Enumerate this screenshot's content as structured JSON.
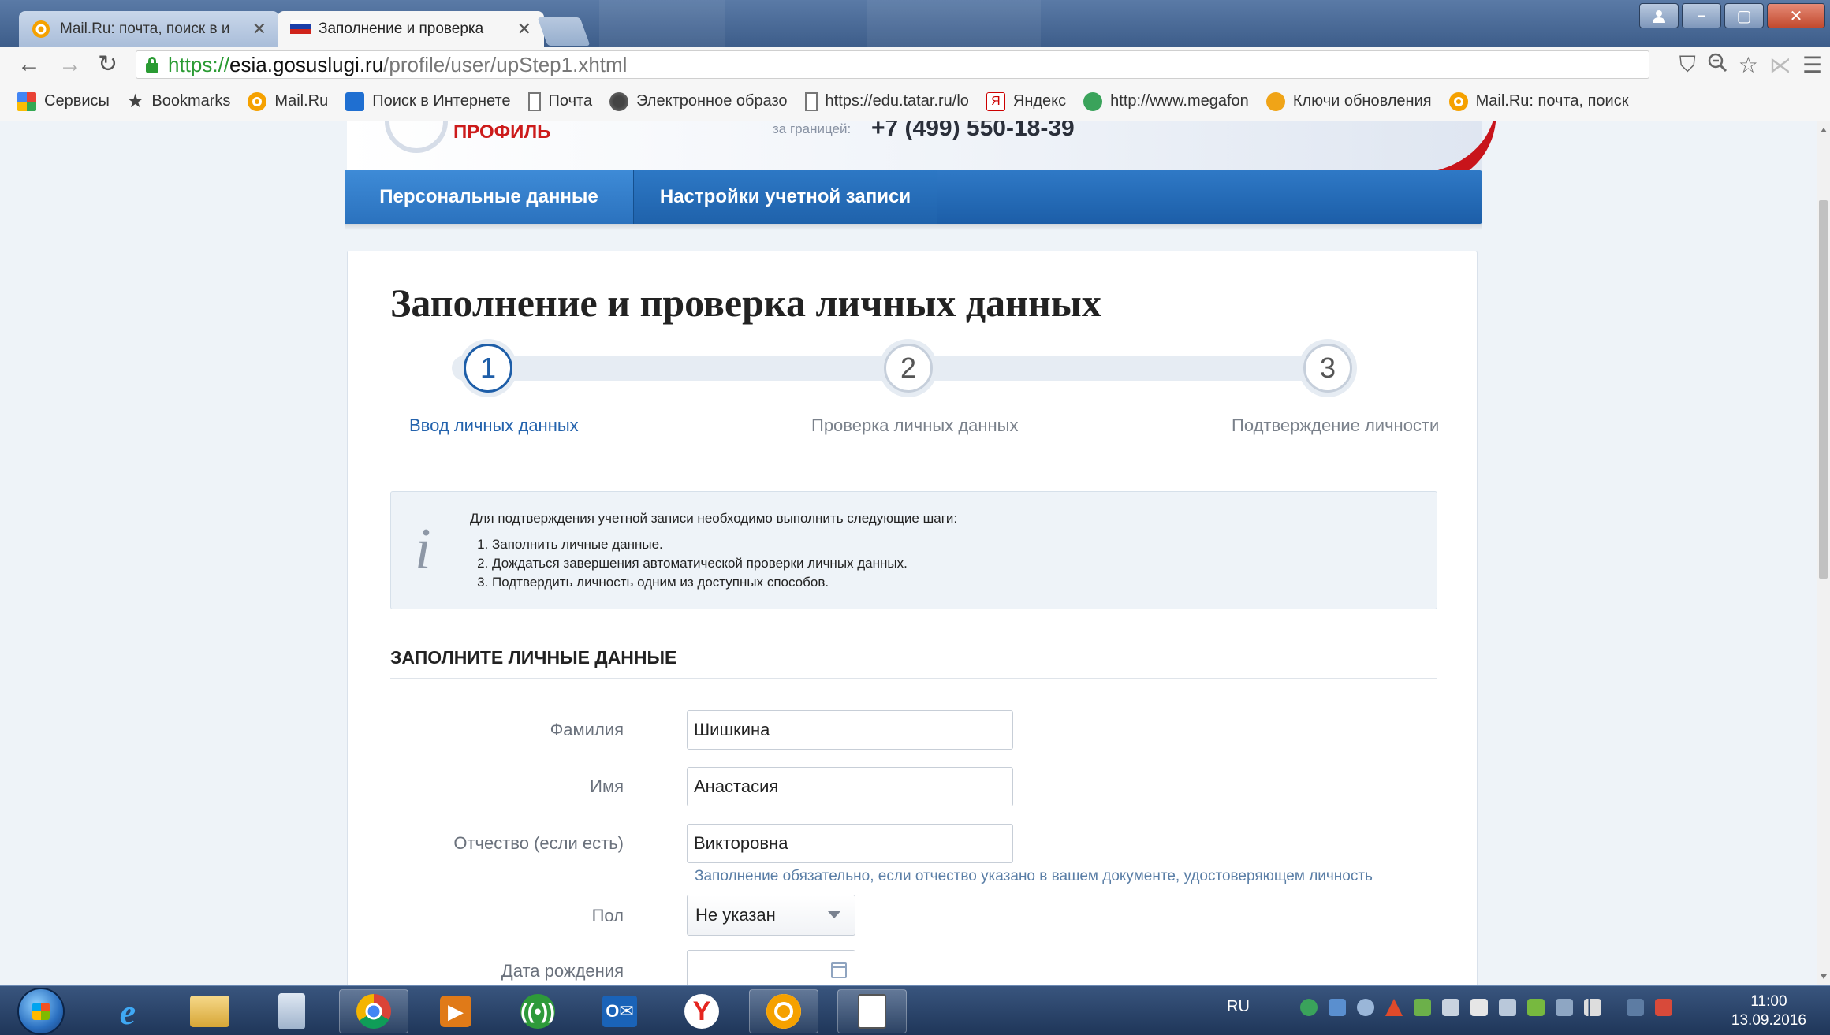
{
  "browser": {
    "tabs": [
      {
        "title": "Mail.Ru: почта, поиск в и",
        "favicon": "mailru-icon",
        "active": false
      },
      {
        "title": "Заполнение и проверка",
        "favicon": "russia-flag-icon",
        "active": true
      }
    ],
    "url": {
      "scheme": "https://",
      "host": "esia.gosuslugi.ru",
      "path": "/profile/user/upStep1.xhtml"
    },
    "bookmarks": [
      {
        "label": "Сервисы",
        "icon": "apps-grid-icon"
      },
      {
        "label": "Bookmarks",
        "icon": "star-icon"
      },
      {
        "label": "Mail.Ru",
        "icon": "mailru-icon"
      },
      {
        "label": "Поиск в Интернете",
        "icon": "search-icon"
      },
      {
        "label": "Почта",
        "icon": "page-icon"
      },
      {
        "label": "Электронное образо",
        "icon": "globe-icon"
      },
      {
        "label": "https://edu.tatar.ru/lo",
        "icon": "page-icon"
      },
      {
        "label": "Яндекс",
        "icon": "yandex-icon"
      },
      {
        "label": "http://www.megafon",
        "icon": "megafon-icon"
      },
      {
        "label": "Ключи обновления",
        "icon": "keys-icon"
      },
      {
        "label": "Mail.Ru: почта, поиск",
        "icon": "mailru-icon"
      }
    ]
  },
  "header": {
    "logo_text": "ПРОФИЛЬ",
    "phone_label": "за границей:",
    "phone": "+7 (499) 550-18-39"
  },
  "profile_tabs": [
    {
      "label": "Персональные данные",
      "active": true
    },
    {
      "label": "Настройки учетной записи",
      "active": false
    }
  ],
  "page_title": "Заполнение и проверка личных данных",
  "steps": [
    {
      "number": "1",
      "label": "Ввод личных данных",
      "active": true
    },
    {
      "number": "2",
      "label": "Проверка личных данных",
      "active": false
    },
    {
      "number": "3",
      "label": "Подтверждение личности",
      "active": false
    }
  ],
  "info": {
    "heading": "Для подтверждения учетной записи необходимо выполнить следующие шаги:",
    "items": [
      "Заполнить личные данные.",
      "Дождаться завершения автоматической проверки личных данных.",
      "Подтвердить личность одним из доступных способов."
    ]
  },
  "form": {
    "section_title": "ЗАПОЛНИТЕ ЛИЧНЫЕ ДАННЫЕ",
    "surname": {
      "label": "Фамилия",
      "value": "Шишкина"
    },
    "name": {
      "label": "Имя",
      "value": "Анастасия"
    },
    "patronymic": {
      "label": "Отчество (если есть)",
      "value": "Викторовна",
      "hint": "Заполнение обязательно, если отчество указано в вашем документе, удостоверяющем личность"
    },
    "gender": {
      "label": "Пол",
      "value": "Не указан"
    },
    "birthdate": {
      "label": "Дата рождения",
      "value": ""
    }
  },
  "taskbar": {
    "language": "RU",
    "time": "11:00",
    "date": "13.09.2016"
  },
  "colors": {
    "accent_blue": "#1e5ea8",
    "tab_blue": "#2f79c6",
    "logo_red": "#cc1b1b",
    "https_green": "#2a9b33"
  }
}
